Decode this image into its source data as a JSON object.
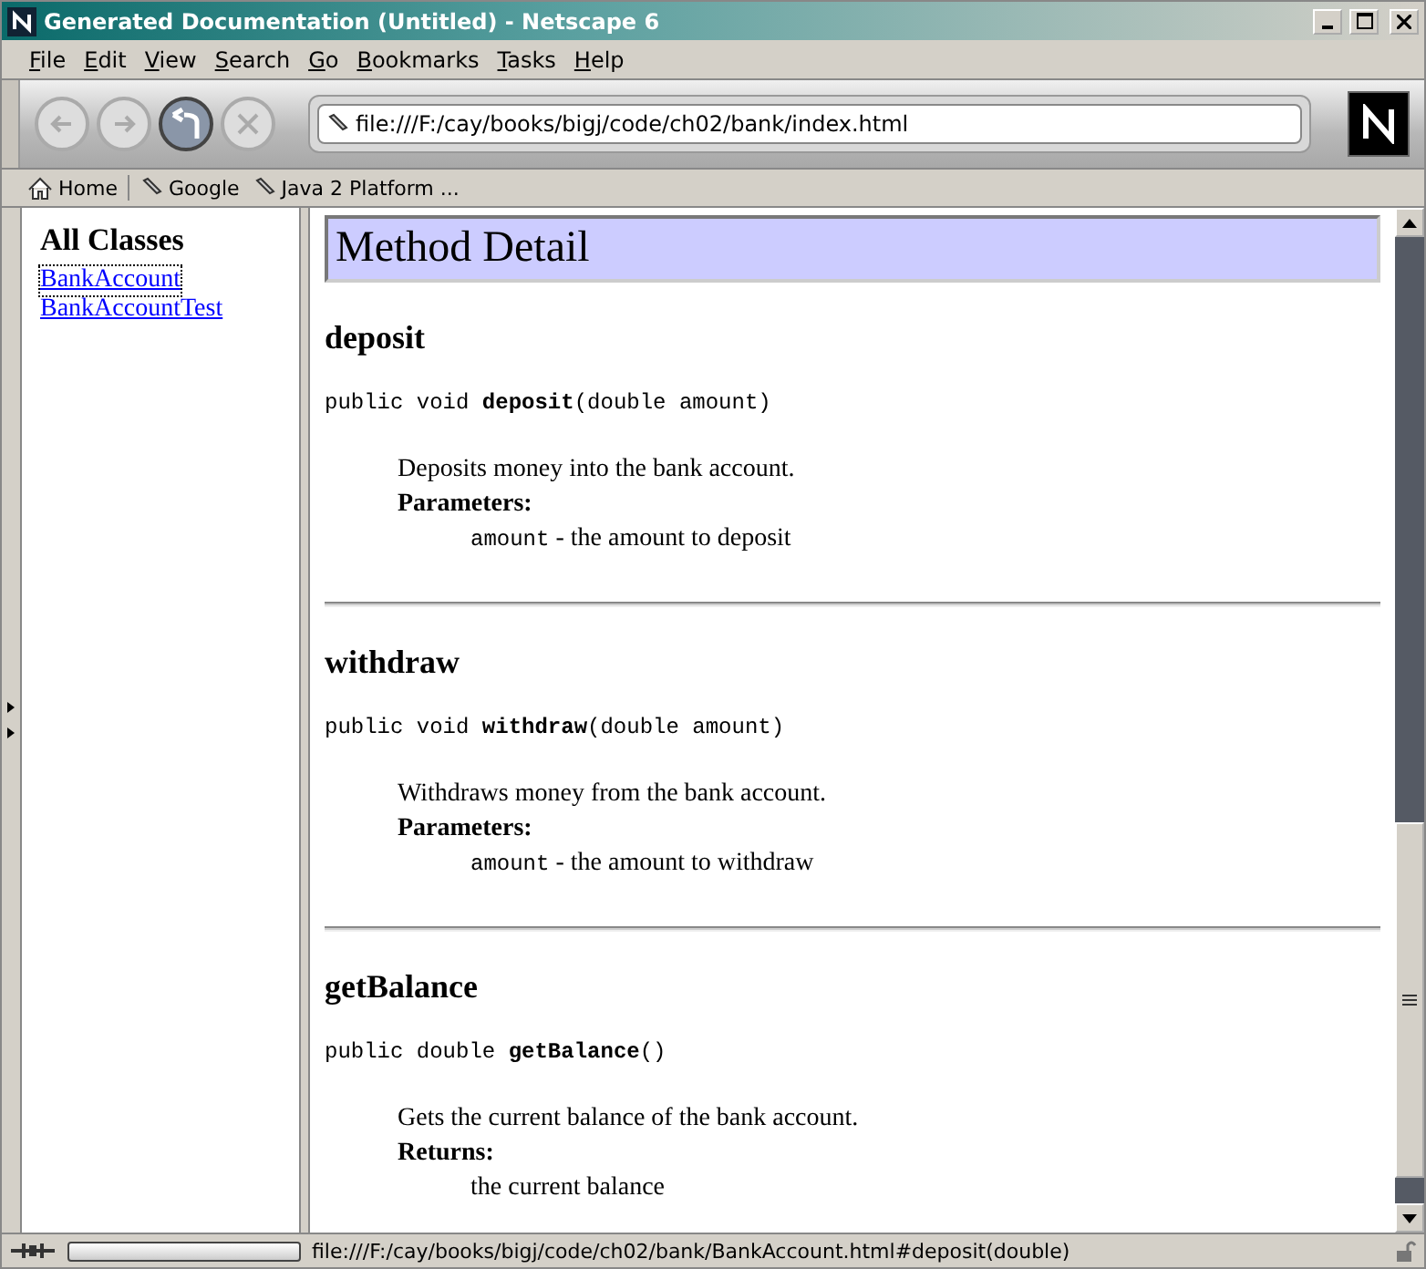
{
  "window": {
    "title": "Generated Documentation (Untitled) - Netscape 6"
  },
  "menu": [
    "File",
    "Edit",
    "View",
    "Search",
    "Go",
    "Bookmarks",
    "Tasks",
    "Help"
  ],
  "address": {
    "value": "file:///F:/cay/books/bigj/code/ch02/bank/index.html"
  },
  "bookmarks": [
    {
      "label": "Home",
      "kind": "home"
    },
    {
      "label": "Google",
      "kind": "link"
    },
    {
      "label": "Java 2 Platform ...",
      "kind": "link"
    }
  ],
  "sidebar": {
    "title": "All Classes",
    "items": [
      {
        "label": "BankAccount",
        "selected": true
      },
      {
        "label": "BankAccountTest",
        "selected": false
      }
    ]
  },
  "heading": "Method Detail",
  "methods": [
    {
      "name": "deposit",
      "signature": "public void **deposit**(double amount)",
      "description": "Deposits money into the bank account.",
      "section": "Parameters:",
      "detail": {
        "code": "amount",
        "text": " - the amount to deposit"
      }
    },
    {
      "name": "withdraw",
      "signature": "public void **withdraw**(double amount)",
      "description": "Withdraws money from the bank account.",
      "section": "Parameters:",
      "detail": {
        "code": "amount",
        "text": " - the amount to withdraw"
      }
    },
    {
      "name": "getBalance",
      "signature": "public double **getBalance**()",
      "description": "Gets the current balance of the bank account.",
      "section": "Returns:",
      "detail": {
        "text": "the current balance"
      }
    }
  ],
  "status_bar": {
    "progress": {
      "level": 0
    },
    "text": "file:///F:/cay/books/bigj/code/ch02/bank/BankAccount.html#deposit(double)"
  }
}
